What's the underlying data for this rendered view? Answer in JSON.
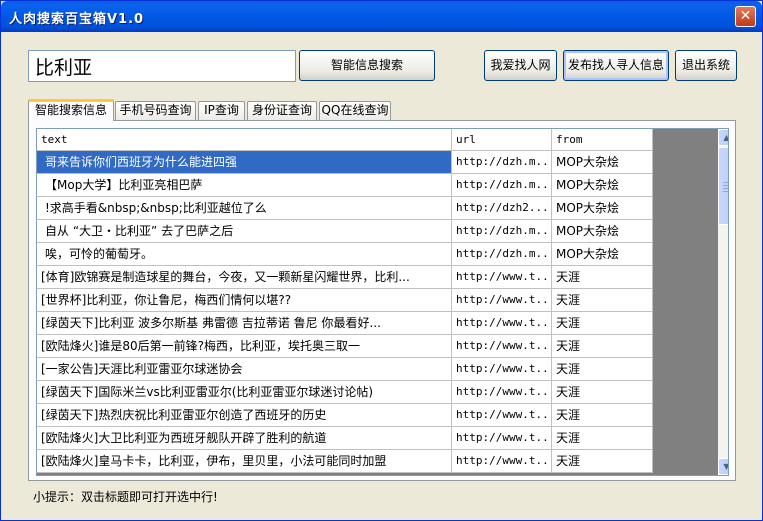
{
  "window": {
    "title": "人肉搜索百宝箱V1.0",
    "close_label": "✕"
  },
  "search": {
    "value": "比利亚",
    "button_label": "智能信息搜索"
  },
  "buttons": {
    "love": "我爱找人网",
    "publish": "发布找人寻人信息",
    "exit": "退出系统"
  },
  "tabs": [
    "智能搜索信息",
    "手机号码查询",
    "IP查询",
    "身份证查询",
    "QQ在线查询"
  ],
  "columns": [
    "text",
    "url",
    "from"
  ],
  "rows": [
    {
      "text": "哥来告诉你们西班牙为什么能进四强",
      "url": "http://dzh.m...",
      "from": "MOP大杂烩"
    },
    {
      "text": "【Mop大学】比利亚亮相巴萨",
      "url": "http://dzh.m...",
      "from": "MOP大杂烩"
    },
    {
      "text": "!求高手看&nbsp;&nbsp;比利亚越位了么",
      "url": "http://dzh2....",
      "from": "MOP大杂烩"
    },
    {
      "text": "自从 “大卫・比利亚” 去了巴萨之后",
      "url": "http://dzh.m...",
      "from": "MOP大杂烩"
    },
    {
      "text": "唉，可怜的葡萄牙。",
      "url": "http://dzh.m...",
      "from": "MOP大杂烩"
    },
    {
      "text": "[体育]欧锦赛是制造球星的舞台，今夜，又一颗新星闪耀世界，比利...",
      "url": "http://www.t...",
      "from": "天涯"
    },
    {
      "text": "[世界杯]比利亚，你让鲁尼，梅西们情何以堪??",
      "url": "http://www.t...",
      "from": "天涯"
    },
    {
      "text": "[绿茵天下]比利亚 波多尔斯基 弗雷德 吉拉蒂诺 鲁尼 你最看好...",
      "url": "http://www.t...",
      "from": "天涯"
    },
    {
      "text": "[欧陆烽火]谁是80后第一前锋?梅西，比利亚，埃托奥三取一",
      "url": "http://www.t...",
      "from": "天涯"
    },
    {
      "text": "[一家公告]天涯比利亚雷亚尔球迷协会",
      "url": "http://www.t...",
      "from": "天涯"
    },
    {
      "text": "[绿茵天下]国际米兰vs比利亚雷亚尔(比利亚雷亚尔球迷讨论帖)",
      "url": "http://www.t...",
      "from": "天涯"
    },
    {
      "text": "[绿茵天下]热烈庆祝比利亚雷亚尔创造了西班牙的历史",
      "url": "http://www.t...",
      "from": "天涯"
    },
    {
      "text": "[欧陆烽火]大卫比利亚为西班牙舰队开辟了胜利的航道",
      "url": "http://www.t...",
      "from": "天涯"
    },
    {
      "text": "[欧陆烽火]皇马卡卡，比利亚，伊布，里贝里，小法可能同时加盟",
      "url": "http://www.t...",
      "from": "天涯"
    }
  ],
  "hint": "小提示：双击标题即可打开选中行!",
  "scrollbar": {
    "up": "▲",
    "down": "▼"
  },
  "colors": {
    "selection": "#316ac5",
    "titlebar": "#0058e6",
    "tab_accent": "#ffc83c"
  }
}
